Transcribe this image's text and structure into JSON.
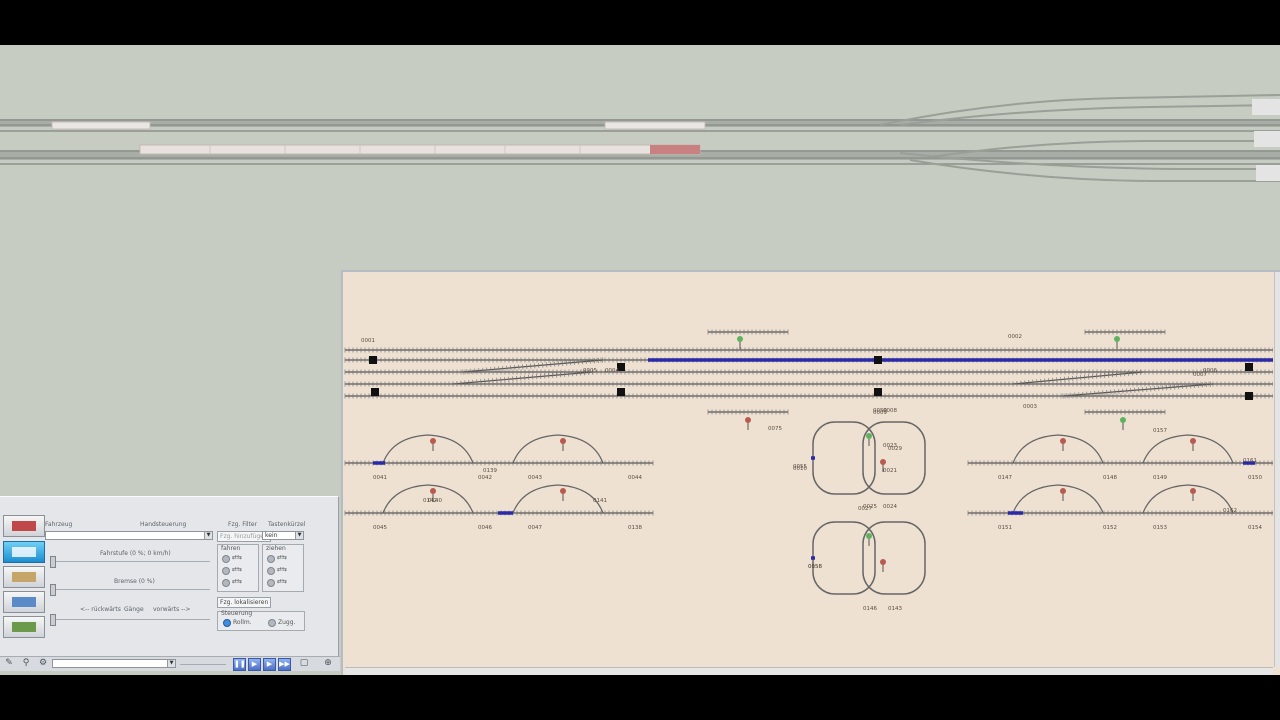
{
  "panel": {
    "vehicle_label": "Fahrzeug",
    "manual_label": "Handsteuerung",
    "filter_label": "Fzg. Filter",
    "keys_label": "Tastenkürzel",
    "add_vehicle": "Fzg. hinzufügen",
    "keys_value": "kein",
    "speed_label": "Fahrstufe (0 %; 0 km/h)",
    "brake_label": "Bremse (0 %)",
    "backward": "<-- rückwärts",
    "gears": "Gänge",
    "forward": "vorwärts -->",
    "group_fahren": "fahren",
    "group_ziehen": "ziehen",
    "locate_vehicle": "Fzg. lokalisieren",
    "control_group": "Steuerung",
    "radio_rollm": "Rollm.",
    "radio_zugg": "Zugg."
  },
  "track_labels": [
    "0041",
    "0042",
    "0043",
    "0044",
    "0045",
    "0046",
    "0047",
    "0138",
    "0147",
    "0148",
    "0149",
    "0150",
    "0151",
    "0152",
    "0153",
    "0154",
    "0001",
    "0002",
    "0003",
    "0004",
    "0005",
    "0006",
    "0007",
    "0008",
    "0009",
    "0010",
    "0025",
    "0027",
    "0050",
    "0055",
    "0056",
    "0075",
    "0146",
    "0143",
    "0029",
    "0024",
    "0023",
    "0021",
    "0139",
    "0140",
    "0141",
    "0142",
    "0157",
    "0158",
    "0161",
    "0162"
  ],
  "colors": {
    "scene_bg": "#c6ccc2",
    "panel_bg": "#eee1d2",
    "occupied_track": "#2a2aa8",
    "signal_green": "#5fb35f",
    "signal_red": "#b85a50"
  }
}
